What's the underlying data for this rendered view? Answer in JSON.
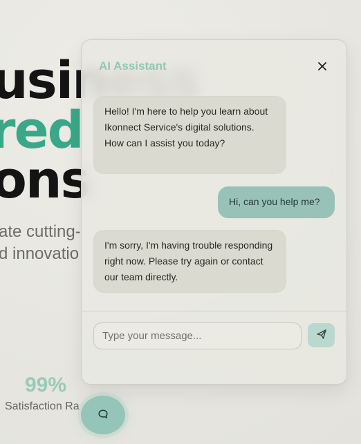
{
  "background": {
    "hero": {
      "line_1": "usin",
      "line_1_tail": "ess",
      "line_2": "red",
      "line_3": "ons",
      "subtitle_1": "ate cutting-",
      "subtitle_2": "d innovatio"
    },
    "stat": {
      "value": "99%",
      "label": "Satisfaction Ra"
    },
    "colors": {
      "accent": "#3aa888",
      "dark_text": "#141414"
    }
  },
  "chat": {
    "title": "AI Assistant",
    "messages": [
      {
        "role": "assistant",
        "text": "Hello! I'm here to help you learn about Ikonnect Service's digital solutions. How can I assist you today?"
      },
      {
        "role": "user",
        "text": "Hi, can you help me?"
      },
      {
        "role": "assistant",
        "text": "I'm sorry, I'm having trouble responding right now. Please try again or contact our team directly."
      }
    ],
    "input": {
      "value": "",
      "placeholder": "Type your message..."
    },
    "icons": {
      "close": "close-icon",
      "send": "send-icon",
      "launcher": "chat-bubble-icon"
    },
    "colors": {
      "title": "#93c6b7",
      "assistant_bubble": "#d9d9d0",
      "user_bubble": "#98c2b7",
      "send_button": "#b9d8cf",
      "launcher": "#95c4b8"
    }
  }
}
